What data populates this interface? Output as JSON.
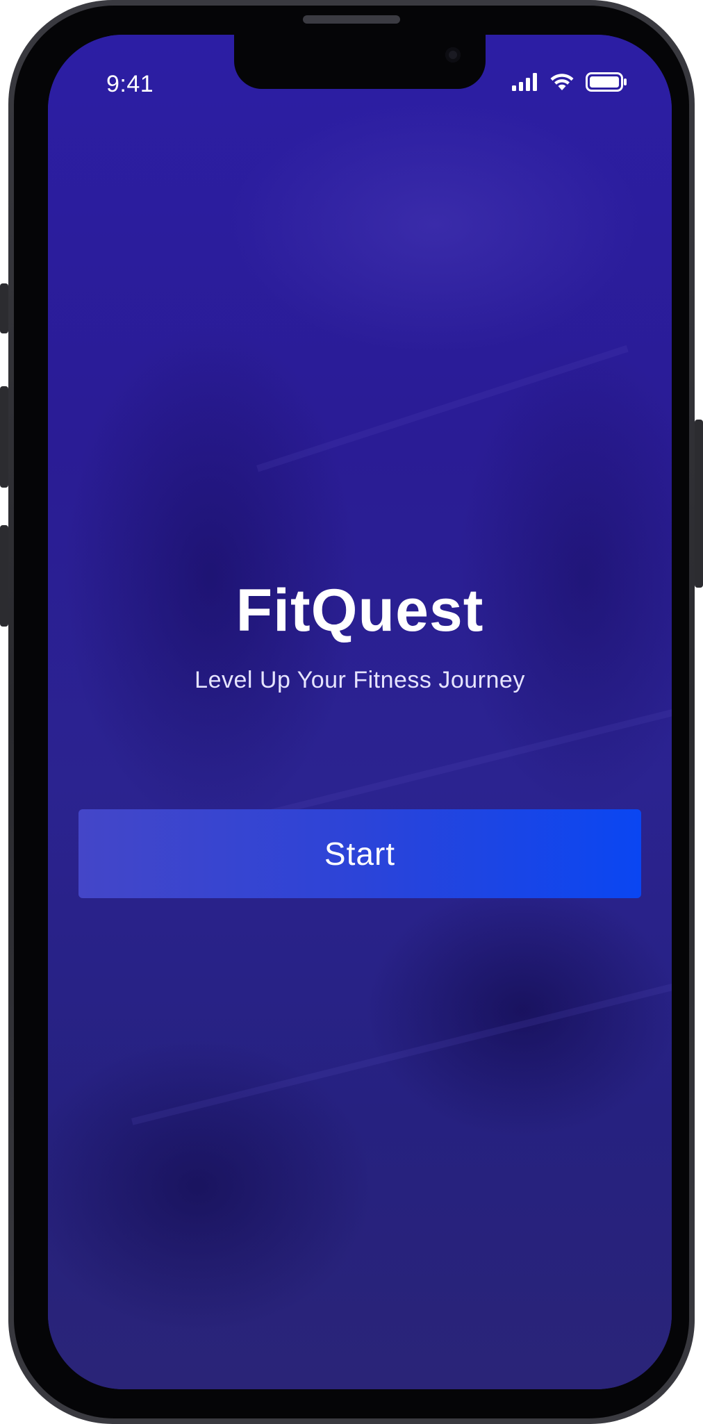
{
  "status_bar": {
    "time": "9:41",
    "icons": [
      "signal-icon",
      "wifi-icon",
      "battery-icon"
    ]
  },
  "app": {
    "title": "FitQuest",
    "tagline": "Level Up Your Fitness Journey",
    "start_label": "Start"
  },
  "colors": {
    "background_tint": "#281c8f",
    "button_start": "#4446c8",
    "button_end": "#0a46f2",
    "text": "#ffffff"
  }
}
